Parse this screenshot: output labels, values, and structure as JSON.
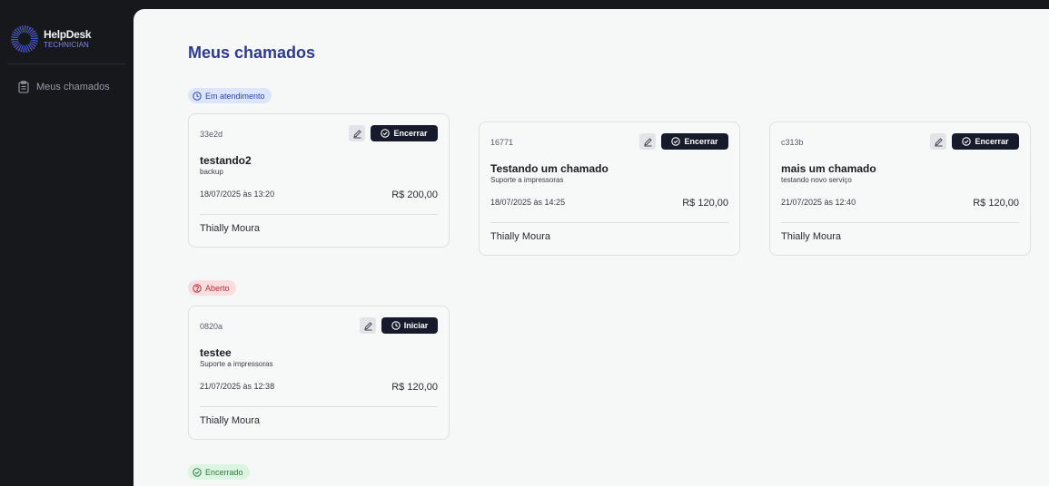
{
  "sidebar": {
    "brand_name": "HelpDesk",
    "brand_role": "TECHNICIAN",
    "nav": [
      {
        "label": "Meus chamados",
        "icon": "clipboard-icon"
      }
    ]
  },
  "main": {
    "title": "Meus chamados",
    "sections": [
      {
        "status": "Em atendimento",
        "icon": "clock-icon",
        "color": "#2d44a8"
      },
      {
        "status": "Aberto",
        "icon": "help-circle-icon",
        "color": "#b2303c"
      },
      {
        "status": "Encerrado",
        "icon": "check-circle-icon",
        "color": "#2f7a3f"
      }
    ],
    "in_progress_cards": [
      {
        "id": "33e2d",
        "title": "testando2",
        "subtitle": "backup",
        "datetime": "18/07/2025 às 13:20",
        "price": "R$ 200,00",
        "technician": "Thially Moura",
        "action": "Encerrar"
      },
      {
        "id": "16771",
        "title": "Testando um chamado",
        "subtitle": "Suporte a impressoras",
        "datetime": "18/07/2025 às 14:25",
        "price": "R$ 120,00",
        "technician": "Thially Moura",
        "action": "Encerrar"
      },
      {
        "id": "c313b",
        "title": "mais um chamado",
        "subtitle": "testando novo serviço",
        "datetime": "21/07/2025 às 12:40",
        "price": "R$ 120,00",
        "technician": "Thially Moura",
        "action": "Encerrar"
      }
    ],
    "open_cards": [
      {
        "id": "0820a",
        "title": "testee",
        "subtitle": "Suporte a impressoras",
        "datetime": "21/07/2025 às 12:38",
        "price": "R$ 120,00",
        "technician": "Thially Moura",
        "action": "Iniciar"
      }
    ]
  }
}
